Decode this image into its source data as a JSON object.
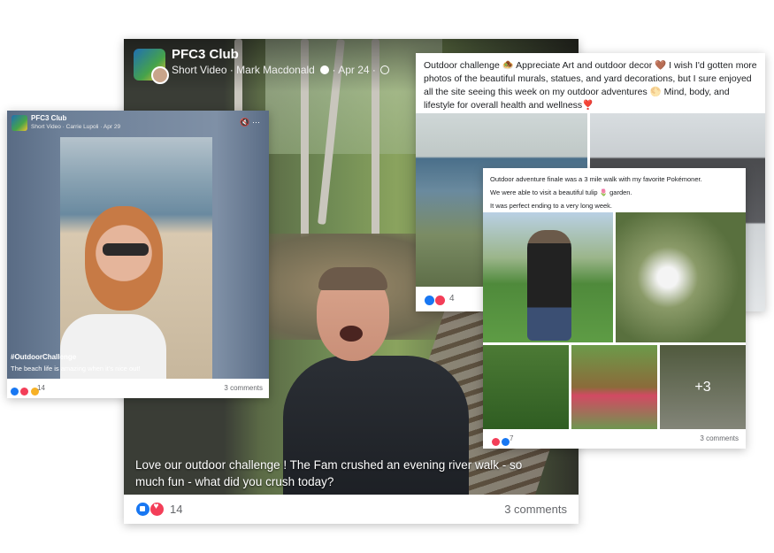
{
  "main_post": {
    "group": "PFC3 Club",
    "meta": "Short Video · Mark Macdonald",
    "date": "Apr 24",
    "caption": "Love our outdoor challenge !  The Fam crushed an evening river walk - so much fun - what did you crush today?",
    "reaction_count": "14",
    "comments": "3 comments"
  },
  "left_post": {
    "group": "PFC3 Club",
    "meta": "Short Video · Carrie Lupoli",
    "date": "Apr 29",
    "hashtag": "#OutdoorChallenge",
    "caption": "The beach life is amazing when it's nice out!",
    "reaction_count": "14",
    "comments": "3 comments",
    "icons": {
      "mute": "speaker-off-icon",
      "more": "more-icon"
    }
  },
  "top_right_post": {
    "text": "Outdoor challenge 🧆 Appreciate Art and outdoor decor 🤎 I wish I'd gotten more photos of the beautiful murals, statues, and yard decorations, but I sure enjoyed all the site seeing this week on my outdoor adventures 🌕 Mind, body, and lifestyle for overall health and wellness❣️",
    "reaction_count": "4"
  },
  "front_right_post": {
    "line1": "Outdoor adventure finale was a 3 mile walk with my favorite Pokémoner.",
    "line2": "We were able to visit a beautiful tulip 🌷 garden.",
    "line3": "It was perfect ending to a very long week.",
    "more_photos": "+3",
    "reaction_count": "7",
    "comments": "3 comments"
  },
  "colors": {
    "like": "#1877f2",
    "love": "#f33e58",
    "care": "#f7b125"
  }
}
